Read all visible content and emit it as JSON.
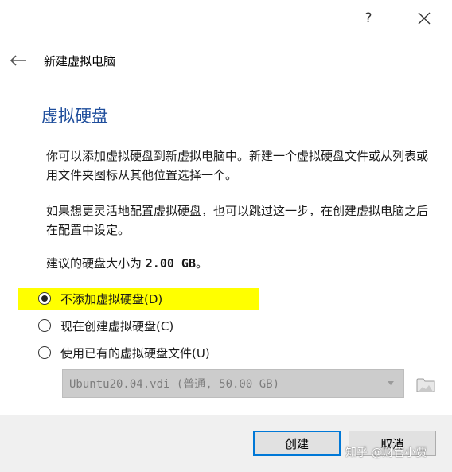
{
  "titlebar": {
    "help_label": "?"
  },
  "wizard": {
    "title": "新建虚拟电脑"
  },
  "page": {
    "title": "虚拟硬盘",
    "para1": "你可以添加虚拟硬盘到新虚拟电脑中。新建一个虚拟硬盘文件或从列表或用文件夹图标从其他位置选择一个。",
    "para2": "如果想更灵活地配置虚拟硬盘，也可以跳过这一步，在创建虚拟电脑之后在配置中设定。",
    "recommend_prefix": "建议的硬盘大小为 ",
    "recommend_size": "2.00 GB",
    "recommend_suffix": "。"
  },
  "options": {
    "none": "不添加虚拟硬盘(D)",
    "create": "现在创建虚拟硬盘(C)",
    "existing": "使用已有的虚拟硬盘文件(U)",
    "selected": "none"
  },
  "disk_select": {
    "value": "Ubuntu20.04.vdi (普通, 50.00 GB)"
  },
  "buttons": {
    "create": "创建",
    "cancel": "取消"
  },
  "watermark": "知乎 @财管小贾",
  "colors": {
    "accent": "#1f4e9c",
    "highlight": "#ffff00",
    "focus": "#0078d7"
  }
}
